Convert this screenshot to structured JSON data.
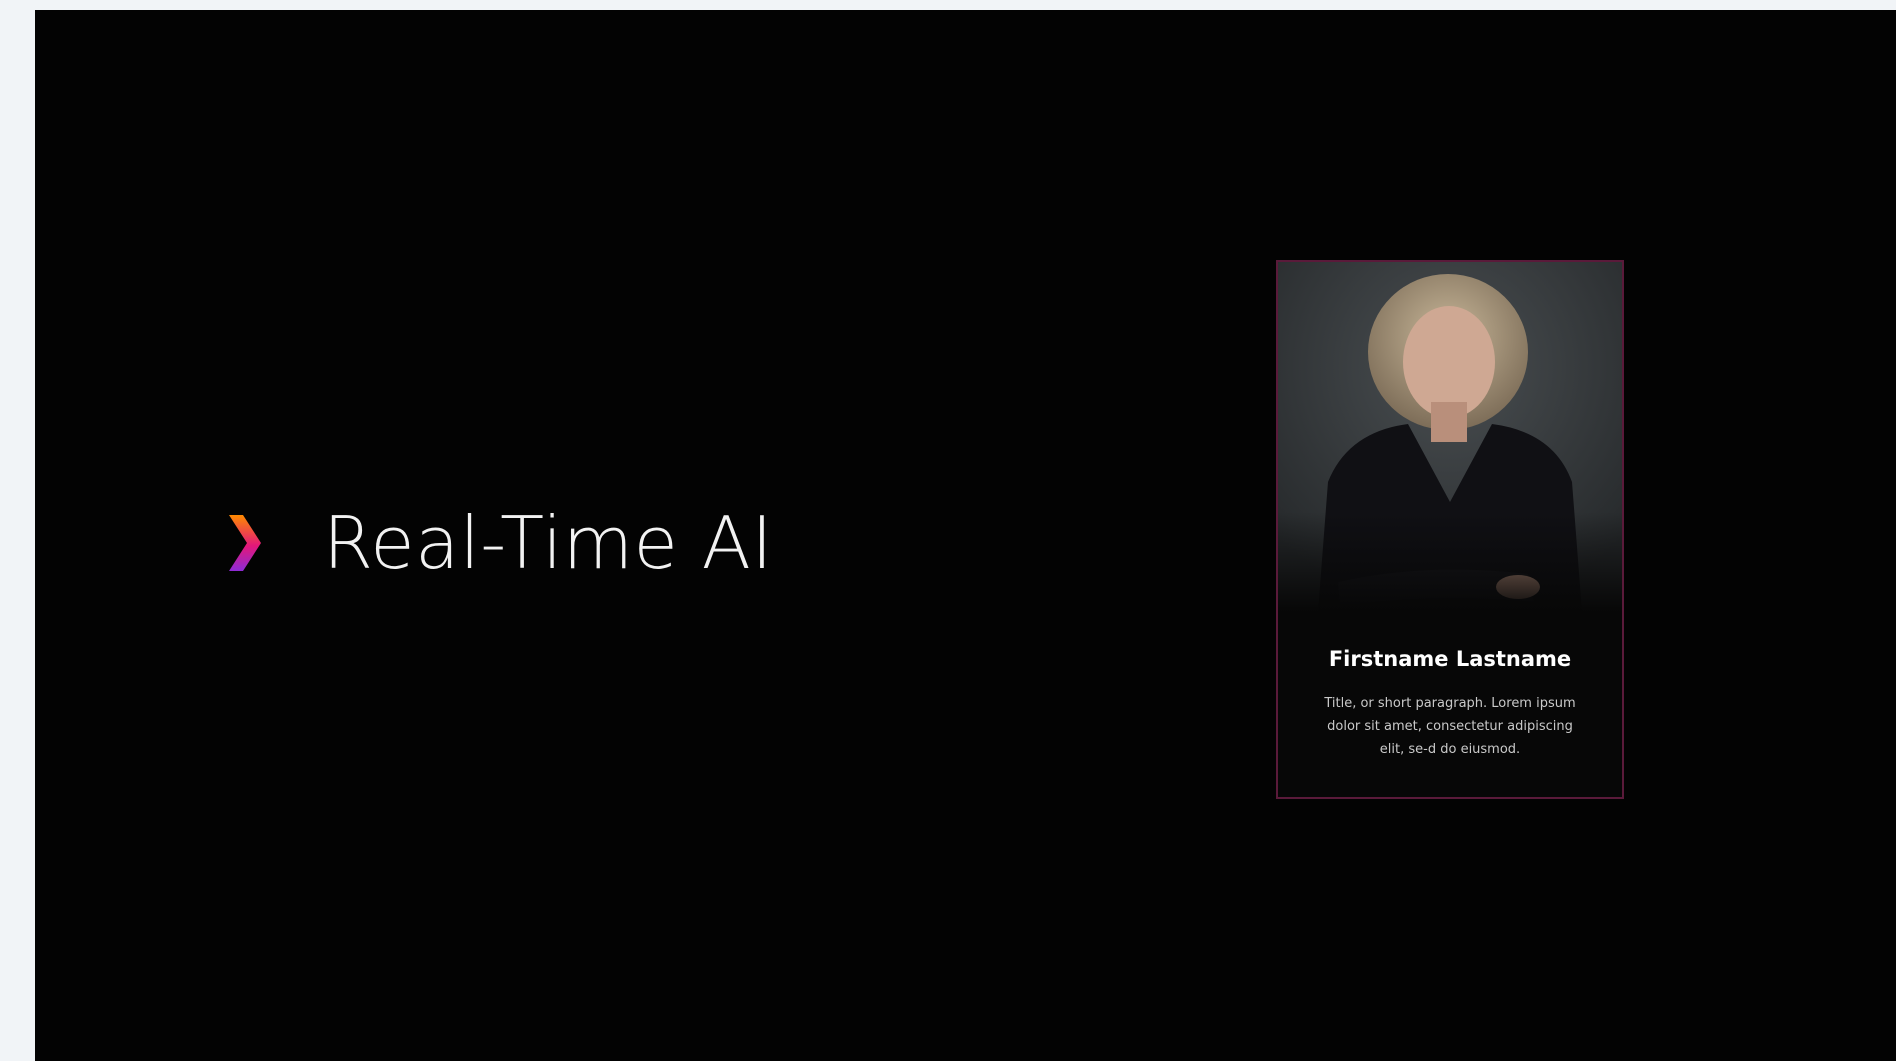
{
  "slide": {
    "background_color": "#030303",
    "headline": {
      "icon": "chevron-right-gradient-icon",
      "text": "Real-Time AI",
      "gradient_colors": [
        "#ff8a00",
        "#e3177a",
        "#8d2bd6"
      ]
    },
    "profile_card": {
      "photo": "portrait-photo",
      "name": "Firstname Lastname",
      "description": "Title, or short paragraph. Lorem ipsum dolor sit amet, consectetur adipiscing elit, se-d do eiusmod.",
      "border_color": "#5a1a3a"
    }
  }
}
